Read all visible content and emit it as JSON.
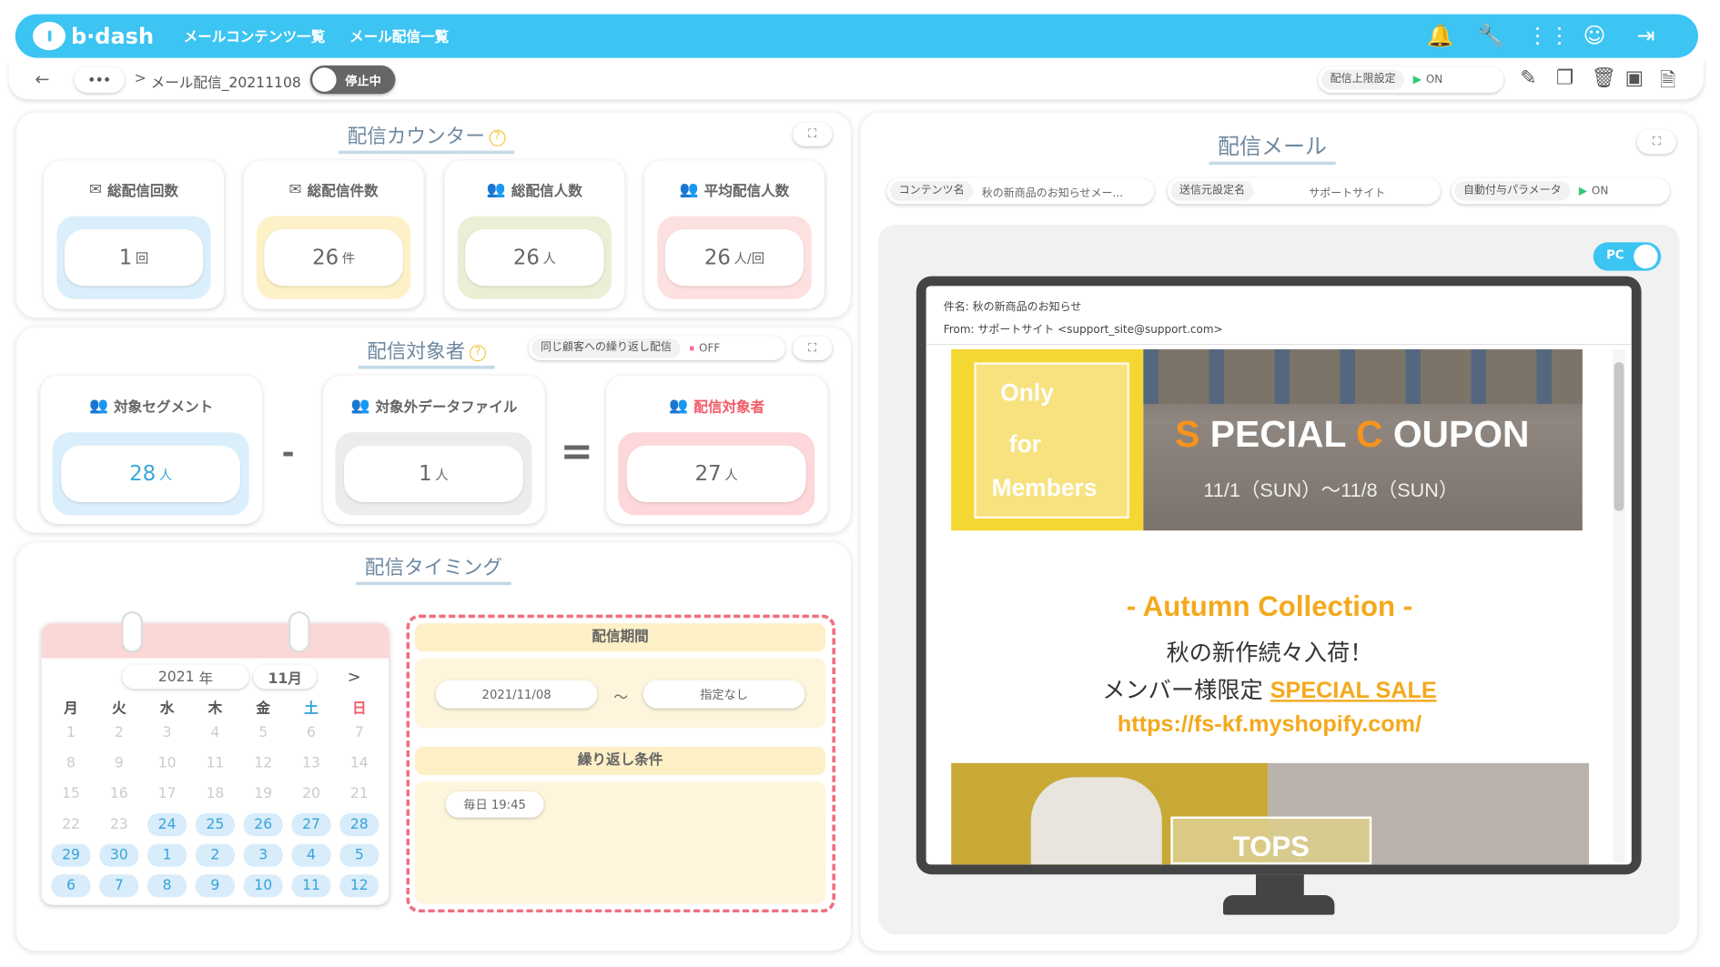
{
  "app": {
    "logo": "b·dash"
  },
  "nav": {
    "content_list": "メールコンテンツ一覧",
    "delivery_list": "メール配信一覧"
  },
  "breadcrumb": {
    "back": "←",
    "more": "•••",
    "sep": ">",
    "name": "メール配信_20211108"
  },
  "status_toggle": {
    "label": "停止中"
  },
  "limit": {
    "label": "配信上限設定",
    "state": "ON"
  },
  "counter": {
    "title": "配信カウンター",
    "cards": [
      {
        "label": "総配信回数",
        "value": "1",
        "unit": "回",
        "icon": "envelope-icon",
        "bg": "#dbeefb"
      },
      {
        "label": "総配信件数",
        "value": "26",
        "unit": "件",
        "icon": "envelope-icon",
        "bg": "#fdf1c7"
      },
      {
        "label": "総配信人数",
        "value": "26",
        "unit": "人",
        "icon": "people-icon",
        "bg": "#e9f0d6"
      },
      {
        "label": "平均配信人数",
        "value": "26",
        "unit": "人/回",
        "icon": "people-icon",
        "bg": "#fde0e0"
      }
    ]
  },
  "target": {
    "title": "配信対象者",
    "repeat_label": "同じ顧客への繰り返し配信",
    "repeat_state": "OFF",
    "segment": {
      "label": "対象セグメント",
      "value": "28",
      "unit": "人"
    },
    "minus": "-",
    "exclude": {
      "label": "対象外データファイル",
      "value": "1",
      "unit": "人"
    },
    "equals": "=",
    "result": {
      "label": "配信対象者",
      "value": "27",
      "unit": "人"
    }
  },
  "timing": {
    "title": "配信タイミング",
    "calendar": {
      "year": "2021",
      "year_unit": "年",
      "month": "11月",
      "next": ">",
      "weekdays": [
        "月",
        "火",
        "水",
        "木",
        "金",
        "土",
        "日"
      ],
      "rows": [
        [
          "1",
          "2",
          "3",
          "4",
          "5",
          "6",
          "7"
        ],
        [
          "8",
          "9",
          "10",
          "11",
          "12",
          "13",
          "14"
        ],
        [
          "15",
          "16",
          "17",
          "18",
          "19",
          "20",
          "21"
        ],
        [
          "22",
          "23",
          "24",
          "25",
          "26",
          "27",
          "28"
        ],
        [
          "29",
          "30",
          "1",
          "2",
          "3",
          "4",
          "5"
        ],
        [
          "6",
          "7",
          "8",
          "9",
          "10",
          "11",
          "12"
        ]
      ]
    },
    "period": {
      "title": "配信期間",
      "start": "2021/11/08",
      "tilde": "～",
      "end": "指定なし"
    },
    "repeat": {
      "title": "繰り返し条件",
      "value": "毎日 19:45"
    }
  },
  "mail": {
    "title": "配信メール",
    "content_key": "コンテンツ名",
    "content_val": "秋の新商品のお知らせメー...",
    "sender_key": "送信元設定名",
    "sender_val": "サポートサイト",
    "param_key": "自動付与パラメータ",
    "param_state": "ON",
    "device": "PC",
    "subject": "件名: 秋の新商品のお知らせ",
    "from": "From: サポートサイト <support_site@support.com>",
    "banner": {
      "only": "Only",
      "for": "for",
      "members": "Members",
      "s": "S",
      "pecial": "PECIAL",
      "c": "C",
      "oupon": "OUPON",
      "dates": "11/1（SUN）～11/8（SUN）"
    },
    "body": {
      "headline": "- Autumn Collection -",
      "line1": "秋の新作続々入荷！",
      "line2": "メンバー様限定",
      "sale": "SPECIAL SALE",
      "url": "https://fs-kf.myshopify.com/",
      "tops": "TOPS"
    }
  }
}
